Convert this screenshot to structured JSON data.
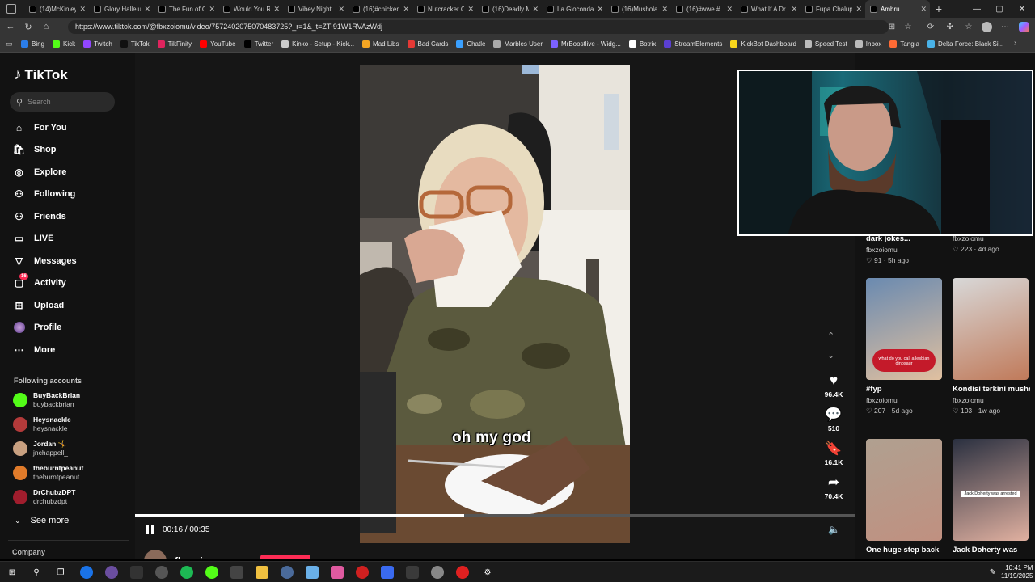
{
  "browser": {
    "tabs": [
      {
        "title": "(14)McKinley"
      },
      {
        "title": "Glory Hallelu"
      },
      {
        "title": "The Fun of C"
      },
      {
        "title": "Would You R"
      },
      {
        "title": "Vibey Night"
      },
      {
        "title": "(16)#chicken"
      },
      {
        "title": "Nutcracker C"
      },
      {
        "title": "(16)Deadly M"
      },
      {
        "title": "La Gioconda"
      },
      {
        "title": "(16)Mushola"
      },
      {
        "title": "(16)#wwe #"
      },
      {
        "title": "What If A Dr"
      },
      {
        "title": "Fupa Chalup"
      },
      {
        "title": "Ambru"
      }
    ],
    "url": "https://www.tiktok.com/@fbxzoiomu/video/7572402075070483725?_r=1&_t=ZT-91W1RVAzWdj",
    "bookmarks": [
      {
        "label": "Bing",
        "color": "#2b7de9"
      },
      {
        "label": "Kick",
        "color": "#53fc18"
      },
      {
        "label": "Twitch",
        "color": "#9146ff"
      },
      {
        "label": "TikTok",
        "color": "#111111"
      },
      {
        "label": "TikFinity",
        "color": "#e0245e"
      },
      {
        "label": "YouTube",
        "color": "#ff0000"
      },
      {
        "label": "Twitter",
        "color": "#000000"
      },
      {
        "label": "Kinko - Setup - Kick...",
        "color": "#cccccc"
      },
      {
        "label": "Mad Libs",
        "color": "#f5a623"
      },
      {
        "label": "Bad Cards",
        "color": "#e53935"
      },
      {
        "label": "Chatle",
        "color": "#3aa0ff"
      },
      {
        "label": "Marbles User",
        "color": "#aaaaaa"
      },
      {
        "label": "MrBoostlive - Widg...",
        "color": "#7b61ff"
      },
      {
        "label": "Botrix",
        "color": "#ffffff"
      },
      {
        "label": "StreamElements",
        "color": "#5a3fd1"
      },
      {
        "label": "KickBot Dashboard",
        "color": "#f9d71c"
      },
      {
        "label": "Speed Test",
        "color": "#bbbbbb"
      },
      {
        "label": "Inbox",
        "color": "#bbbbbb"
      },
      {
        "label": "Tangia",
        "color": "#ff6b35"
      },
      {
        "label": "Delta Force: Black Si...",
        "color": "#4ab3e8"
      }
    ]
  },
  "tiktok": {
    "logo": "TikTok",
    "search_placeholder": "Search",
    "nav": [
      {
        "label": "For You",
        "icon": "home-icon",
        "glyph": "⌂"
      },
      {
        "label": "Shop",
        "icon": "shop-icon",
        "glyph": "🛍"
      },
      {
        "label": "Explore",
        "icon": "compass-icon",
        "glyph": "◎"
      },
      {
        "label": "Following",
        "icon": "following-icon",
        "glyph": "⚇"
      },
      {
        "label": "Friends",
        "icon": "friends-icon",
        "glyph": "⚇"
      },
      {
        "label": "LIVE",
        "icon": "live-icon",
        "glyph": "▭"
      },
      {
        "label": "Messages",
        "icon": "messages-icon",
        "glyph": "▽"
      },
      {
        "label": "Activity",
        "icon": "activity-icon",
        "glyph": "▢"
      },
      {
        "label": "Upload",
        "icon": "upload-icon",
        "glyph": "⊞"
      },
      {
        "label": "Profile",
        "icon": "profile-icon",
        "glyph": "●"
      },
      {
        "label": "More",
        "icon": "more-icon",
        "glyph": "⋯"
      }
    ],
    "activity_badge": "16",
    "following_title": "Following accounts",
    "following": [
      {
        "name": "BuyBackBrian",
        "handle": "buybackbrian",
        "color": "#53fc18"
      },
      {
        "name": "Heysnackle",
        "handle": "heysnackle",
        "color": "#b33a3a"
      },
      {
        "name": "Jordan 🤸",
        "handle": "jnchappell_",
        "color": "#c8a080"
      },
      {
        "name": "theburntpeanut",
        "handle": "theburntpeanut",
        "color": "#e07b2a"
      },
      {
        "name": "DrChubzDPT",
        "handle": "drchubzdpt",
        "color": "#a01d2d"
      }
    ],
    "see_more": "See more",
    "company": "Company"
  },
  "video": {
    "caption": "oh my god",
    "time": "00:16 / 00:35",
    "progress": 0.457,
    "author": "fbxzoiomu",
    "actions": [
      {
        "icon": "heart-icon",
        "glyph": "♥",
        "count": "96.4K"
      },
      {
        "icon": "comment-icon",
        "glyph": "💬",
        "count": "510"
      },
      {
        "icon": "bookmark-icon",
        "glyph": "🔖",
        "count": "16.1K"
      },
      {
        "icon": "share-icon",
        "glyph": "➦",
        "count": "70.4K"
      }
    ]
  },
  "related": [
    {
      "title": "dark jokes...",
      "author": "fbxzoiomu",
      "meta": "♡ 91 · 5h ago"
    },
    {
      "title": "",
      "author": "fbxzoiomu",
      "meta": "♡ 223 · 4d ago"
    },
    {
      "title": "#fyp",
      "author": "fbxzoiomu",
      "meta": "♡ 207 · 5d ago",
      "overlay": "what do you call a lesbian dinosaur"
    },
    {
      "title": "Kondisi terkini mushola PONPES A...",
      "author": "fbxzoiomu",
      "meta": "♡ 103 · 1w ago"
    },
    {
      "title": "One huge step back",
      "author": "",
      "meta": ""
    },
    {
      "title": "Jack Doherty was",
      "author": "",
      "meta": "",
      "overlay": "Jack Doherty was arrested"
    }
  ],
  "taskbar": {
    "time": "10:41 PM",
    "date": "11/19/2025"
  }
}
